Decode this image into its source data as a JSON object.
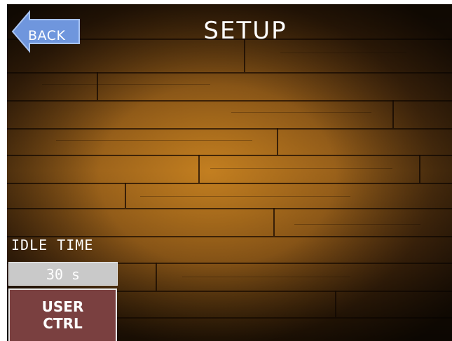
{
  "header": {
    "title": "SETUP",
    "back_label": "BACK",
    "back_icon": "left-arrow-icon",
    "back_color": "#6f96dd"
  },
  "settings": {
    "idle_time_label": "IDLE TIME",
    "idle_time_value": "30 s",
    "user_ctrl_line1": "USER",
    "user_ctrl_line2": "CTRL"
  },
  "colors": {
    "user_ctrl_bg": "#7a4040",
    "idle_value_bg": "#c9c9c9",
    "background": "wood-floor"
  }
}
